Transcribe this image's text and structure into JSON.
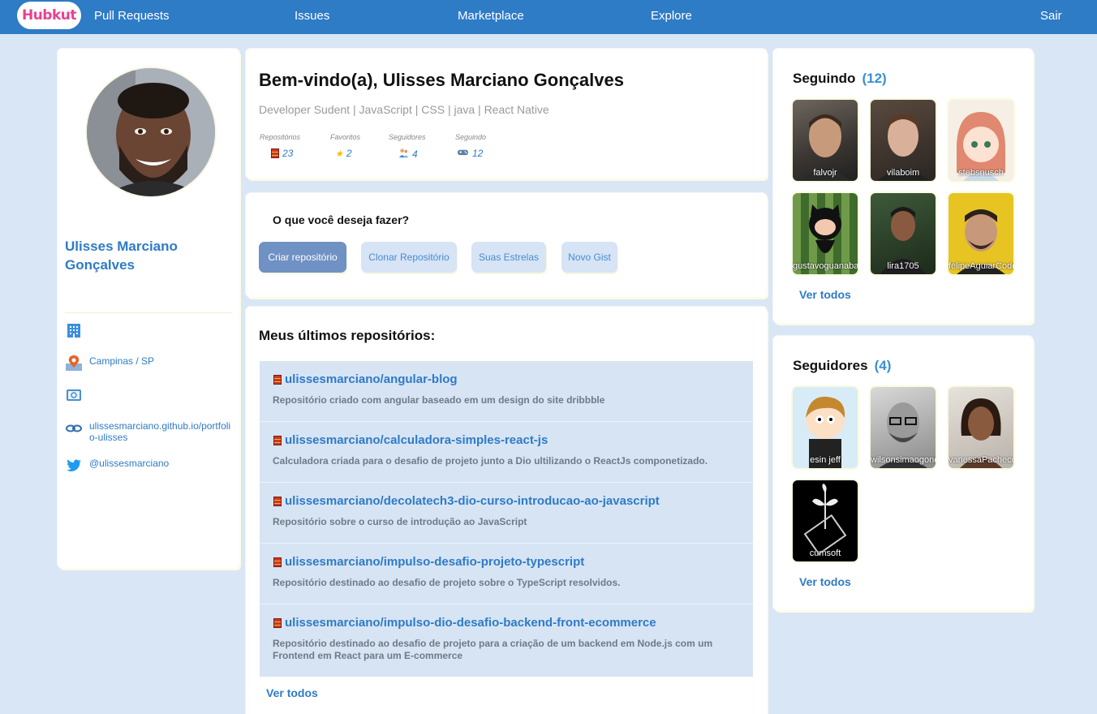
{
  "nav": {
    "logo": "Hubkut",
    "links": [
      "Pull Requests",
      "Issues",
      "Marketplace",
      "Explore"
    ],
    "logout": "Sair"
  },
  "profile": {
    "name": "Ulisses Marciano Gonçalves",
    "company": "",
    "location": "Campinas / SP",
    "email": "",
    "website": "ulissesmarciano.github.io/portfolio-ulisses",
    "twitter": "@ulissesmarciano"
  },
  "welcome": {
    "title": "Bem-vindo(a), Ulisses Marciano Gonçalves",
    "subtitle": "Developer Sudent | JavaScript | CSS | java | React Native",
    "stats": [
      {
        "label": "Repositórios",
        "value": "23",
        "icon": "brick-icon"
      },
      {
        "label": "Favoritos",
        "value": "2",
        "icon": "star-icon"
      },
      {
        "label": "Seguidores",
        "value": "4",
        "icon": "people-icon"
      },
      {
        "label": "Seguindo",
        "value": "12",
        "icon": "gamepad-icon"
      }
    ]
  },
  "actions": {
    "question": "O que você deseja fazer?",
    "buttons": [
      "Criar repositório",
      "Clonar Repositório",
      "Suas Estrelas",
      "Novo Gist"
    ]
  },
  "repositories": {
    "title": "Meus últimos repositórios:",
    "items": [
      {
        "name": "ulissesmarciano/angular-blog",
        "description": "Repositório criado com angular baseado em um design do site dribbble"
      },
      {
        "name": "ulissesmarciano/calculadora-simples-react-js",
        "description": "Calculadora criada para o desafio de projeto junto a Dio ultilizando o ReactJs componetizado."
      },
      {
        "name": "ulissesmarciano/decolatech3-dio-curso-introducao-ao-javascript",
        "description": "Repositório sobre o curso de introdução ao JavaScript"
      },
      {
        "name": "ulissesmarciano/impulso-desafio-projeto-typescript",
        "description": "Repositório destinado ao desafio de projeto sobre o TypeScript resolvidos."
      },
      {
        "name": "ulissesmarciano/impulso-dio-desafio-backend-front-ecommerce",
        "description": "Repositório destinado ao desafio de projeto para a criação de um backend em Node.js com um Frontend em React para um E-commerce"
      }
    ],
    "see_all": "Ver todos"
  },
  "following": {
    "title": "Seguindo",
    "count": "(12)",
    "people": [
      "falvojr",
      "vilaboim",
      "stebsnusch",
      "gustavoguanabara",
      "lira1705",
      "felipeAguiarCode"
    ],
    "see_all": "Ver todos"
  },
  "followers": {
    "title": "Seguidores",
    "count": "(4)",
    "people": [
      "esin   jeff",
      "wilsonsimaogonca",
      "vanessaPacheco",
      "cumsoft"
    ],
    "see_all": "Ver todos"
  },
  "colors": {
    "primary": "#2e7bc6",
    "background": "#d9e6f6",
    "logo": "#e8418f"
  }
}
